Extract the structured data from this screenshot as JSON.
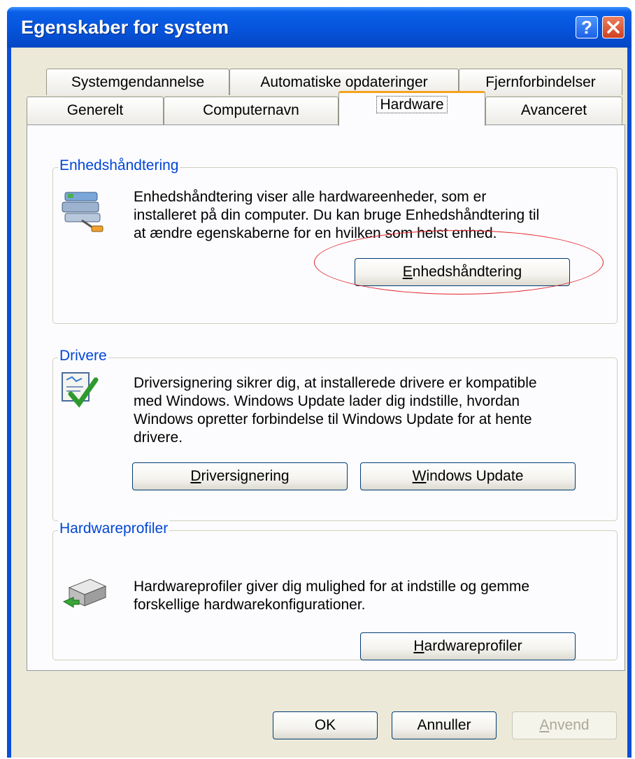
{
  "window": {
    "title": "Egenskaber for system"
  },
  "titlebar_buttons": {
    "help": "?",
    "close": "X"
  },
  "tabs": {
    "row1": [
      "Systemgendannelse",
      "Automatiske opdateringer",
      "Fjernforbindelser"
    ],
    "row2": [
      "Generelt",
      "Computernavn",
      "Hardware",
      "Avanceret"
    ],
    "active": "Hardware"
  },
  "device_manager": {
    "title": "Enhedshåndtering",
    "lines": [
      "Enhedshåndtering viser alle hardwareenheder, som er",
      "installeret på din computer. Du kan bruge Enhedshåndtering til",
      "at ændre egenskaberne for en hvilken som helst enhed."
    ],
    "button": {
      "mnemonic": "E",
      "rest": "nhedshåndtering"
    }
  },
  "drivers": {
    "title": "Drivere",
    "lines": [
      "Driversignering sikrer dig, at installerede drivere er kompatible",
      "med Windows. Windows Update lader dig indstille, hvordan",
      "Windows opretter forbindelse til Windows Update for at hente",
      "drivere."
    ],
    "signing_button": {
      "mnemonic": "D",
      "rest": "riversignering"
    },
    "update_button": {
      "mnemonic": "W",
      "rest": "indows Update"
    }
  },
  "hardware_profiles": {
    "title": "Hardwareprofiler",
    "lines": [
      "Hardwareprofiler giver dig mulighed for at indstille og gemme",
      "forskellige hardwarekonfigurationer."
    ],
    "button": {
      "mnemonic": "H",
      "rest": "ardwareprofiler"
    }
  },
  "footer": {
    "ok": "OK",
    "cancel": "Annuller",
    "apply": {
      "mnemonic": "A",
      "rest": "nvend",
      "enabled": false
    }
  },
  "colors": {
    "accent_title": "#0046d5",
    "highlight_ellipse": "#e3242b",
    "active_tab_top": "#f3a31d"
  },
  "icons": [
    "device-manager-icon",
    "driver-signing-icon",
    "hardware-profile-icon",
    "help-icon",
    "close-icon"
  ]
}
